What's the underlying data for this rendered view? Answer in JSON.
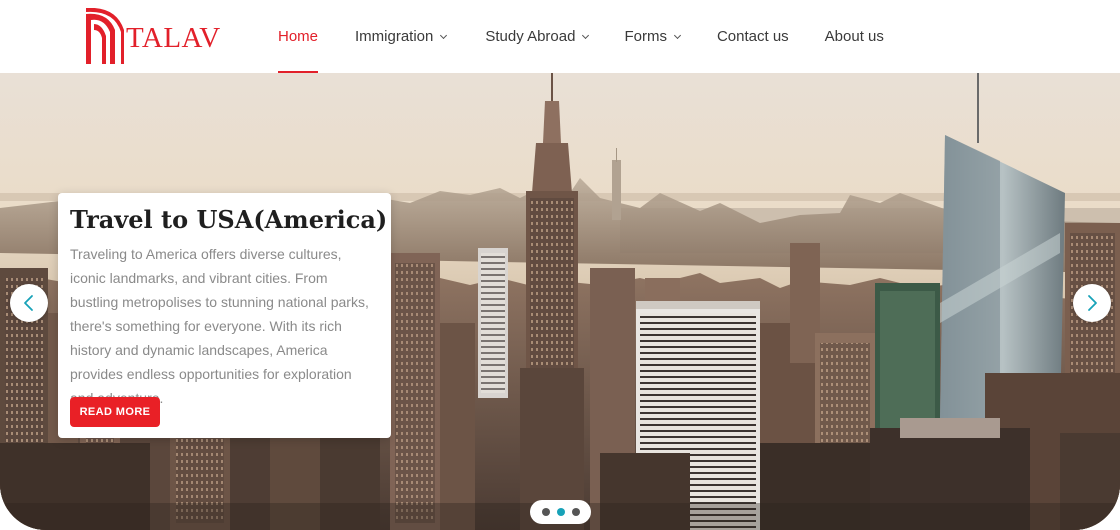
{
  "brand": {
    "name": "TALAV",
    "color": "#e2202a"
  },
  "nav": {
    "items": [
      {
        "label": "Home",
        "active": true,
        "dropdown": false
      },
      {
        "label": "Immigration",
        "active": false,
        "dropdown": true
      },
      {
        "label": "Study Abroad",
        "active": false,
        "dropdown": true
      },
      {
        "label": "Forms",
        "active": false,
        "dropdown": true
      },
      {
        "label": "Contact us",
        "active": false,
        "dropdown": false
      },
      {
        "label": "About us",
        "active": false,
        "dropdown": false
      }
    ]
  },
  "hero": {
    "slide": {
      "title": "Travel to USA(America)",
      "text": "Traveling to America offers diverse cultures, iconic landmarks, and vibrant cities. From bustling metropolises to stunning national parks, there's something for everyone. With its rich history and dynamic landscapes, America provides endless opportunities for exploration and adventure.",
      "button_label": "READ MORE"
    },
    "prev_icon": "chevron-left-icon",
    "next_icon": "chevron-right-icon",
    "dots": 3,
    "active_dot": 2,
    "accent_color": "#17a2b8",
    "button_color": "#e92026"
  }
}
